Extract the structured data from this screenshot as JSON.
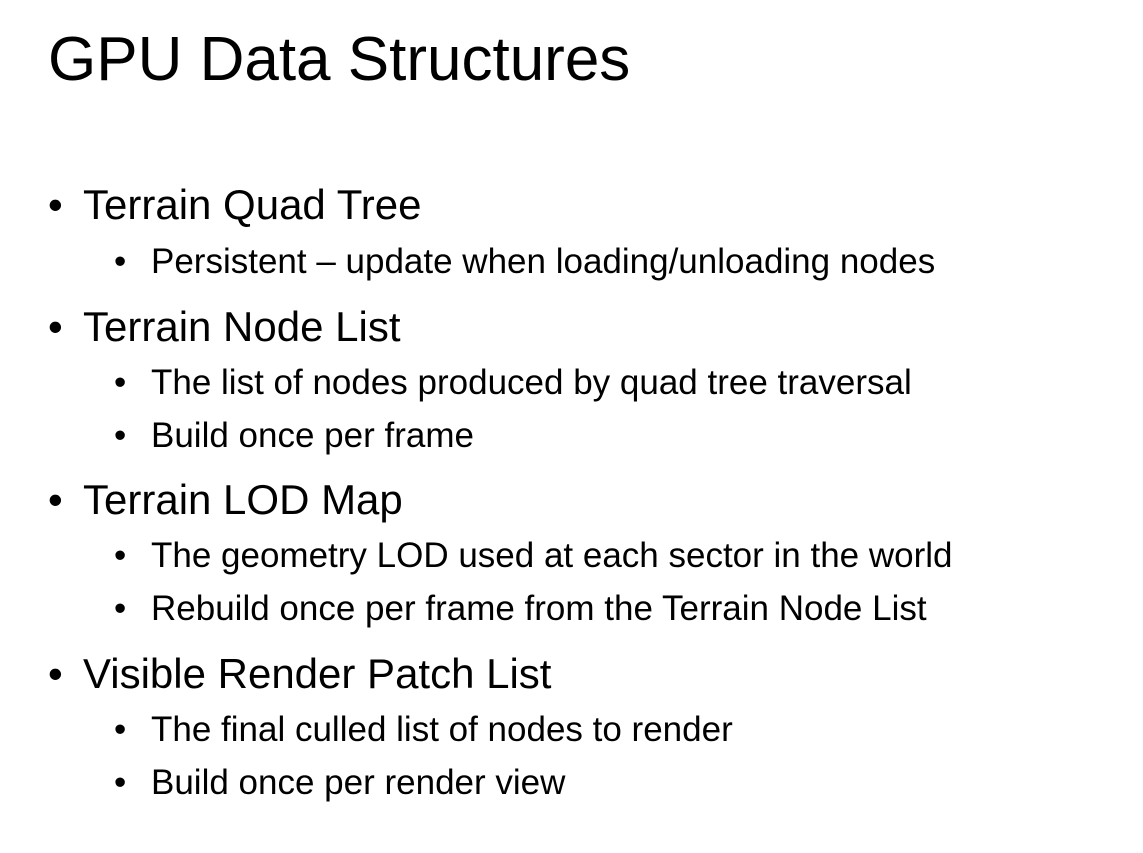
{
  "slide": {
    "title": "GPU Data Structures",
    "bullet_glyph": "•",
    "items": [
      {
        "text": "Terrain Quad Tree",
        "subitems": [
          "Persistent – update when loading/unloading nodes"
        ]
      },
      {
        "text": "Terrain Node List",
        "subitems": [
          "The list of nodes produced by quad tree traversal",
          "Build once per frame"
        ]
      },
      {
        "text": "Terrain LOD Map",
        "subitems": [
          "The geometry LOD used at each sector in the world",
          "Rebuild once per frame from the Terrain Node List"
        ]
      },
      {
        "text": "Visible Render Patch List",
        "subitems": [
          "The final culled list of nodes to render",
          "Build once per render view"
        ]
      }
    ]
  }
}
